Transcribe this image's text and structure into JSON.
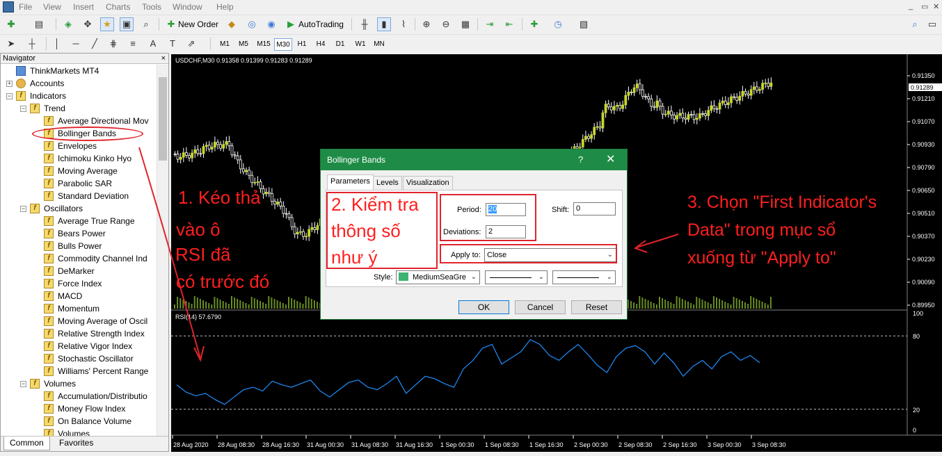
{
  "menu": {
    "items": [
      "File",
      "View",
      "Insert",
      "Charts",
      "Tools",
      "Window",
      "Help"
    ],
    "controls": [
      "_",
      "▭",
      "✕"
    ]
  },
  "toolbar": {
    "new_order": "New Order",
    "autotrading": "AutoTrading",
    "timeframes": [
      "M1",
      "M5",
      "M15",
      "M30",
      "H1",
      "H4",
      "D1",
      "W1",
      "MN"
    ],
    "active_timeframe": "M30",
    "text_tool": "A",
    "label_tool": "T"
  },
  "navigator": {
    "title": "Navigator",
    "close": "×",
    "root": "ThinkMarkets MT4",
    "accounts": "Accounts",
    "indicators": "Indicators",
    "groups": [
      {
        "name": "Trend",
        "items": [
          "Average Directional Mov",
          "Bollinger Bands",
          "Envelopes",
          "Ichimoku Kinko Hyo",
          "Moving Average",
          "Parabolic SAR",
          "Standard Deviation"
        ]
      },
      {
        "name": "Oscillators",
        "items": [
          "Average True Range",
          "Bears Power",
          "Bulls Power",
          "Commodity Channel Ind",
          "DeMarker",
          "Force Index",
          "MACD",
          "Momentum",
          "Moving Average of Oscil",
          "Relative Strength Index",
          "Relative Vigor Index",
          "Stochastic Oscillator",
          "Williams' Percent Range"
        ]
      },
      {
        "name": "Volumes",
        "items": [
          "Accumulation/Distributio",
          "Money Flow Index",
          "On Balance Volume",
          "Volumes"
        ]
      }
    ],
    "tabs": [
      "Common",
      "Favorites"
    ],
    "icon_glyph": "f"
  },
  "chart": {
    "header": "USDCHF,M30  0.91358 0.91399 0.91283 0.91289",
    "price_labels": [
      "0.91350",
      "0.91289",
      "0.91210",
      "0.91070",
      "0.90930",
      "0.90790",
      "0.90650",
      "0.90510",
      "0.90370",
      "0.90230",
      "0.90090",
      "0.89950"
    ],
    "current_price": "0.91289",
    "rsi_label": "RSI(14) 57.6790",
    "rsi_levels": [
      "100",
      "80",
      "20",
      "0"
    ],
    "time_labels": [
      "28 Aug 2020",
      "28 Aug 08:30",
      "28 Aug 16:30",
      "31 Aug 00:30",
      "31 Aug 08:30",
      "31 Aug 16:30",
      "1 Sep 00:30",
      "1 Sep 08:30",
      "1 Sep 16:30",
      "2 Sep 00:30",
      "2 Sep 08:30",
      "2 Sep 16:30",
      "3 Sep 00:30",
      "3 Sep 08:30"
    ],
    "colors": {
      "background": "#000000",
      "candle": "#c8d62a",
      "wick": "#ffffff",
      "rsi": "#1e90ff",
      "volume": "#6b8e23"
    }
  },
  "chart_data": {
    "type": "line",
    "title": "USDCHF,M30",
    "series": [
      {
        "name": "RSI(14)",
        "values": [
          40,
          34,
          31,
          33,
          28,
          24,
          30,
          36,
          38,
          35,
          43,
          40,
          38,
          41,
          44,
          35,
          30,
          36,
          42,
          44,
          38,
          36,
          41,
          47,
          33,
          40,
          47,
          45,
          41,
          38,
          53,
          60,
          70,
          73,
          57,
          62,
          67,
          77,
          73,
          64,
          60,
          67,
          73,
          65,
          56,
          50,
          63,
          70,
          72,
          67,
          57,
          66,
          58,
          47,
          55,
          60,
          53,
          63,
          67,
          60,
          64,
          58
        ]
      }
    ],
    "ylim": [
      0,
      100
    ],
    "levels": [
      80,
      20
    ]
  },
  "dialog": {
    "title": "Bollinger Bands",
    "help": "?",
    "close": "✕",
    "tabs": [
      "Parameters",
      "Levels",
      "Visualization"
    ],
    "period_label": "Period:",
    "period_value": "20",
    "shift_label": "Shift:",
    "shift_value": "0",
    "deviations_label": "Deviations:",
    "deviations_value": "2",
    "apply_label": "Apply to:",
    "apply_value": "Close",
    "style_label": "Style:",
    "style_color_name": "MediumSeaGre",
    "style_color": "#3cb371",
    "ok": "OK",
    "cancel": "Cancel",
    "reset": "Reset"
  },
  "annotations": {
    "step1": [
      "1.     Kéo  thả",
      "vào ô",
      "RSI đã",
      " có trước  đó"
    ],
    "step2": [
      "2. Kiểm tra",
      "thông số",
      "như ý"
    ],
    "step3": [
      "3. Chọn \"First Indicator's",
      "Data\" trong mục sổ",
      "xuống từ \"Apply to\""
    ],
    "color": "#ff1f1f"
  }
}
